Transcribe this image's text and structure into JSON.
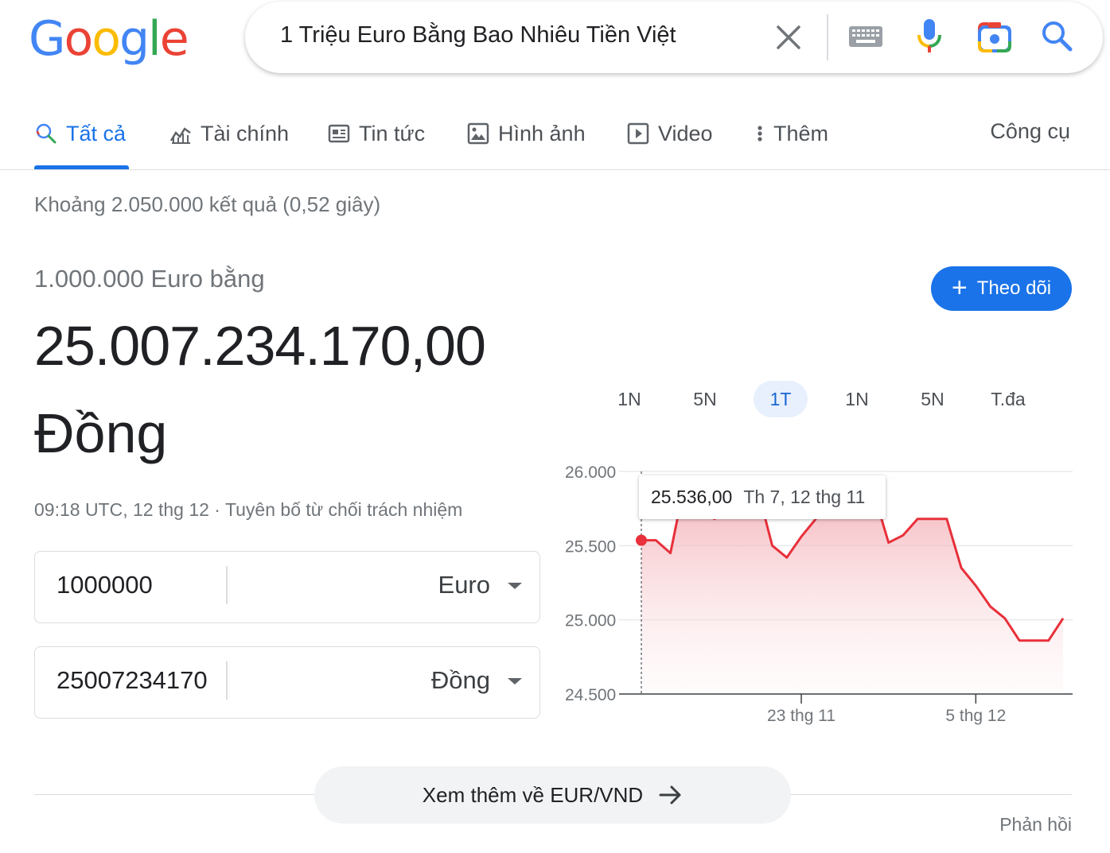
{
  "header": {
    "logo_text": "Google",
    "search_query": "1 Triệu Euro Bằng Bao Nhiêu Tiền Việt"
  },
  "tabs": [
    {
      "label": "Tất cả",
      "icon": "search-icon",
      "active": true
    },
    {
      "label": "Tài chính",
      "icon": "finance-icon"
    },
    {
      "label": "Tin tức",
      "icon": "news-icon"
    },
    {
      "label": "Hình ảnh",
      "icon": "image-icon"
    },
    {
      "label": "Video",
      "icon": "video-icon"
    },
    {
      "label": "Thêm",
      "icon": "more-vert-icon"
    }
  ],
  "tools_label": "Công cụ",
  "result_stats": "Khoảng 2.050.000 kết quả (0,52 giây)",
  "converter": {
    "equals_label": "1.000.000 Euro bằng",
    "result_value": "25.007.234.170,00",
    "result_currency": "Đồng",
    "timestamp": "09:18 UTC, 12 thg 12 · Tuyên bố từ chối trách nhiệm",
    "from": {
      "value": "1000000",
      "currency": "Euro"
    },
    "to": {
      "value": "25007234170",
      "currency": "Đồng"
    }
  },
  "follow_label": "Theo dõi",
  "ranges": [
    {
      "label": "1N"
    },
    {
      "label": "5N"
    },
    {
      "label": "1T",
      "active": true
    },
    {
      "label": "1N"
    },
    {
      "label": "5N"
    },
    {
      "label": "T.đa"
    }
  ],
  "tooltip": {
    "value": "25.536,00",
    "date": "Th 7, 12 thg 11"
  },
  "chart_data": {
    "type": "area",
    "ylim": [
      24500,
      26000
    ],
    "y_ticks": [
      "26.000",
      "25.500",
      "25.000",
      "24.500"
    ],
    "x_ticks": [
      "23 thg 11",
      "5 thg 12"
    ],
    "series": [
      {
        "values": [
          25536,
          25536,
          25450,
          25930,
          25900,
          25680,
          25720,
          25900,
          25880,
          25500,
          25420,
          25560,
          25680,
          25820,
          25780,
          25900,
          25850,
          25520,
          25570,
          25680,
          25680,
          25680,
          25350,
          25230,
          25090,
          25010,
          24860,
          24860,
          24860,
          25010
        ]
      }
    ],
    "line_color": "#e8303a",
    "grid": true
  },
  "more_link": "Xem thêm về EUR/VND",
  "feedback": "Phản hồi"
}
